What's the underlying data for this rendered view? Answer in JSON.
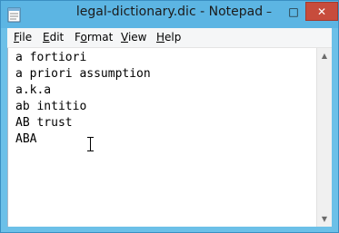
{
  "window": {
    "title": "legal-dictionary.dic - Notepad",
    "accent": "#5cb5e3",
    "close_color": "#c74c3c"
  },
  "controls": {
    "minimize": "–",
    "maximize": "□",
    "close": "✕"
  },
  "menu": [
    {
      "key": "F",
      "rest": "ile"
    },
    {
      "key": "E",
      "rest": "dit"
    },
    {
      "key": "F",
      "rest": "ormat",
      "underline_pos": 1
    },
    {
      "key": "V",
      "rest": "iew"
    },
    {
      "key": "H",
      "rest": "elp"
    }
  ],
  "editor": {
    "lines": [
      "a fortiori",
      "a priori assumption",
      "a.k.a",
      "ab intitio",
      "AB trust",
      "ABA"
    ]
  },
  "icons": {
    "app": "notepad-icon",
    "cursor": "text-cursor-ibeam-icon",
    "scroll_up": "scroll-up-arrow-icon",
    "scroll_down": "scroll-down-arrow-icon"
  },
  "scroll_arrows": {
    "up": "▲",
    "down": "▼"
  }
}
